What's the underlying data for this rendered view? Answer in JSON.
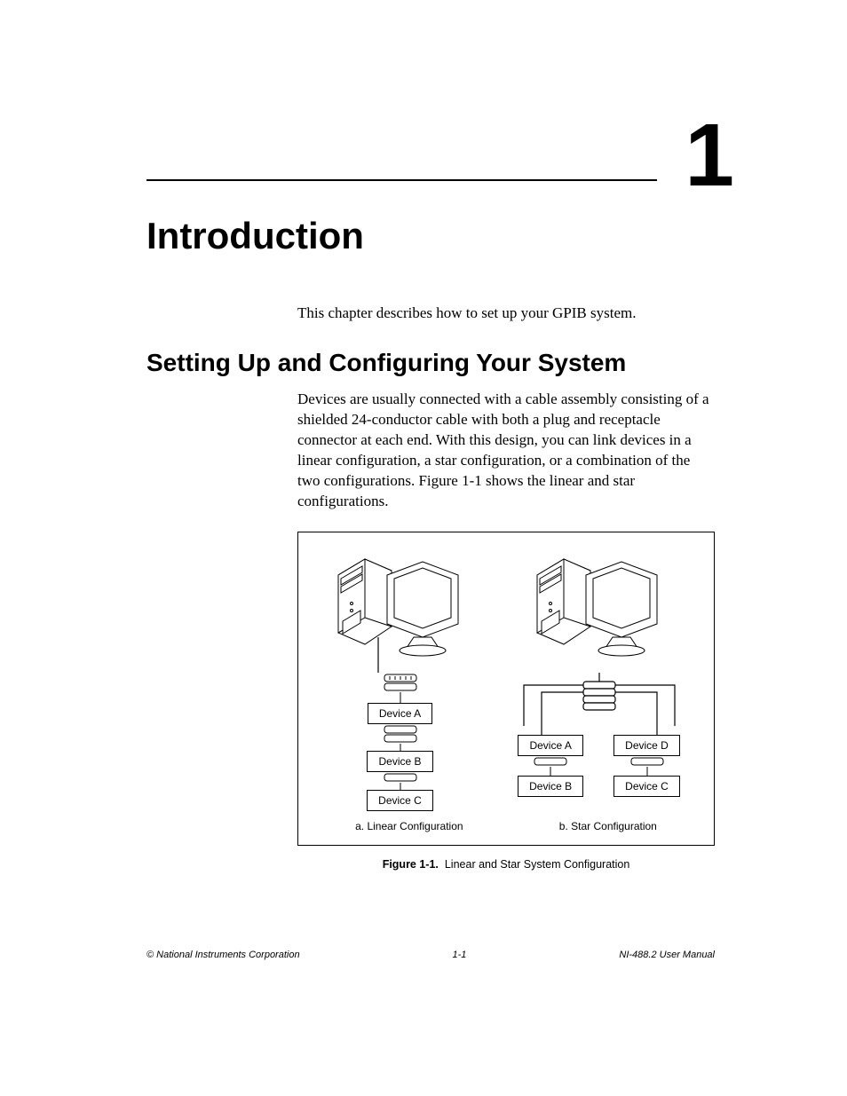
{
  "chapter_number": "1",
  "chapter_title": "Introduction",
  "intro_paragraph": "This chapter describes how to set up your GPIB system.",
  "section_title": "Setting Up and Configuring Your System",
  "body_paragraph": "Devices are usually connected with a cable assembly consisting of a shielded 24-conductor cable with both a plug and receptacle connector at each end. With this design, you can link devices in a linear configuration, a star configuration, or a combination of the two configurations. Figure 1-1 shows the linear and star configurations.",
  "figure": {
    "linear": {
      "caption": "a. Linear Configuration",
      "devices": [
        "Device A",
        "Device B",
        "Device C"
      ]
    },
    "star": {
      "caption": "b. Star Configuration",
      "devices_left": [
        "Device A",
        "Device B"
      ],
      "devices_right": [
        "Device D",
        "Device C"
      ]
    },
    "caption_label": "Figure 1-1.",
    "caption_text": "Linear and Star System Configuration"
  },
  "footer": {
    "left": "© National Instruments Corporation",
    "center": "1-1",
    "right": "NI-488.2 User Manual"
  }
}
